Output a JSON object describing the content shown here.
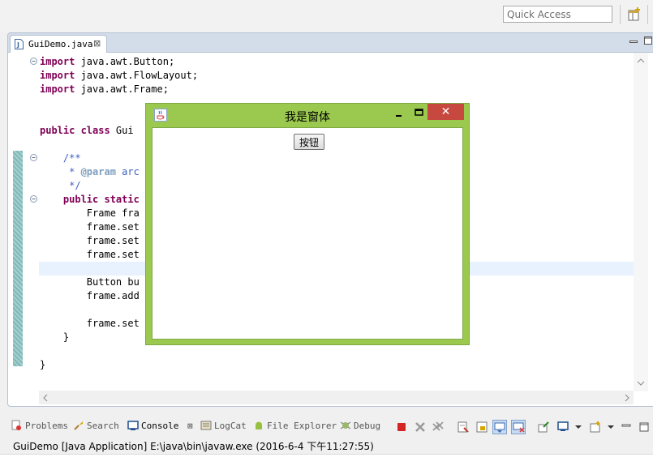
{
  "toolbar": {
    "quick_access_placeholder": "Quick Access"
  },
  "editor": {
    "tab_label": "GuiDemo.java",
    "tab_close": "⊠",
    "lines": [
      {
        "y": 0,
        "parts": [
          [
            "kw",
            "import"
          ],
          [
            "",
            "java.awt.Button;"
          ]
        ]
      },
      {
        "y": 1,
        "parts": [
          [
            "kw",
            "import"
          ],
          [
            "",
            "java.awt.FlowLayout;"
          ]
        ]
      },
      {
        "y": 2,
        "parts": [
          [
            "kw",
            "import"
          ],
          [
            "",
            "java.awt.Frame;"
          ]
        ]
      }
    ],
    "code": {
      "l1_kw": "import",
      "l1_rest": " java.awt.Button;",
      "l2_kw": "import",
      "l2_rest": " java.awt.FlowLayout;",
      "l3_kw": "import",
      "l3_rest": " java.awt.Frame;",
      "l5_kw": "public class",
      "l5_rest": " Gui",
      "l7": "    /**",
      "l8_pre": "     * ",
      "l8_tag": "@param",
      "l8_rest": " arc",
      "l9": "     */",
      "l10_kw": "    public static",
      "l10_rest": "",
      "l11": "        Frame fra",
      "l12": "        frame.set",
      "l13": "        frame.set",
      "l14": "        frame.set",
      "l16": "        Button bu",
      "l17": "        frame.add",
      "l19": "        frame.set",
      "l20": "    }",
      "l22": "}"
    }
  },
  "gui_window": {
    "title": "我是窗体",
    "minimize": "−",
    "close": "✕",
    "button_label": "按钮"
  },
  "views": {
    "problems": "Problems",
    "search": "Search",
    "console": "Console",
    "console_close": "⊠",
    "logcat": "LogCat",
    "file_explorer": "File Explorer",
    "debug": "Debug"
  },
  "console": {
    "status": "GuiDemo [Java Application] E:\\java\\bin\\javaw.exe (2016-6-4 下午11:27:55)"
  },
  "colors": {
    "window_frame": "#9bc94f",
    "close_button": "#c7483e",
    "keyword": "#7f0055",
    "comment": "#3f5fbf"
  }
}
